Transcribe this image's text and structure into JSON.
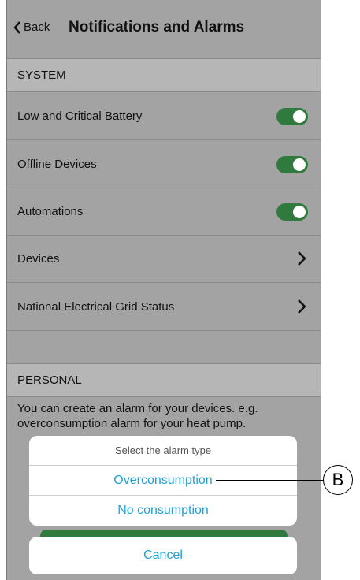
{
  "header": {
    "back_label": "Back",
    "title": "Notifications and Alarms"
  },
  "system_section": {
    "label": "SYSTEM"
  },
  "rows": [
    {
      "label": "Low and Critical Battery",
      "control": "toggle",
      "on": true
    },
    {
      "label": "Offline Devices",
      "control": "toggle",
      "on": true
    },
    {
      "label": "Automations",
      "control": "toggle",
      "on": true
    },
    {
      "label": "Devices",
      "control": "chevron"
    },
    {
      "label": "National Electrical Grid Status",
      "control": "chevron"
    }
  ],
  "personal_section": {
    "label": "PERSONAL",
    "description": "You can create an alarm for your devices. e.g. overconsumption alarm for your heat pump."
  },
  "action_sheet": {
    "title": "Select the alarm type",
    "options": [
      "Overconsumption",
      "No consumption"
    ],
    "cancel_label": "Cancel"
  },
  "callout": {
    "label": "B"
  },
  "colors": {
    "toggle_on": "#2f7a3c",
    "option_text": "#1ea0d6",
    "background": "#a3a3a3"
  }
}
